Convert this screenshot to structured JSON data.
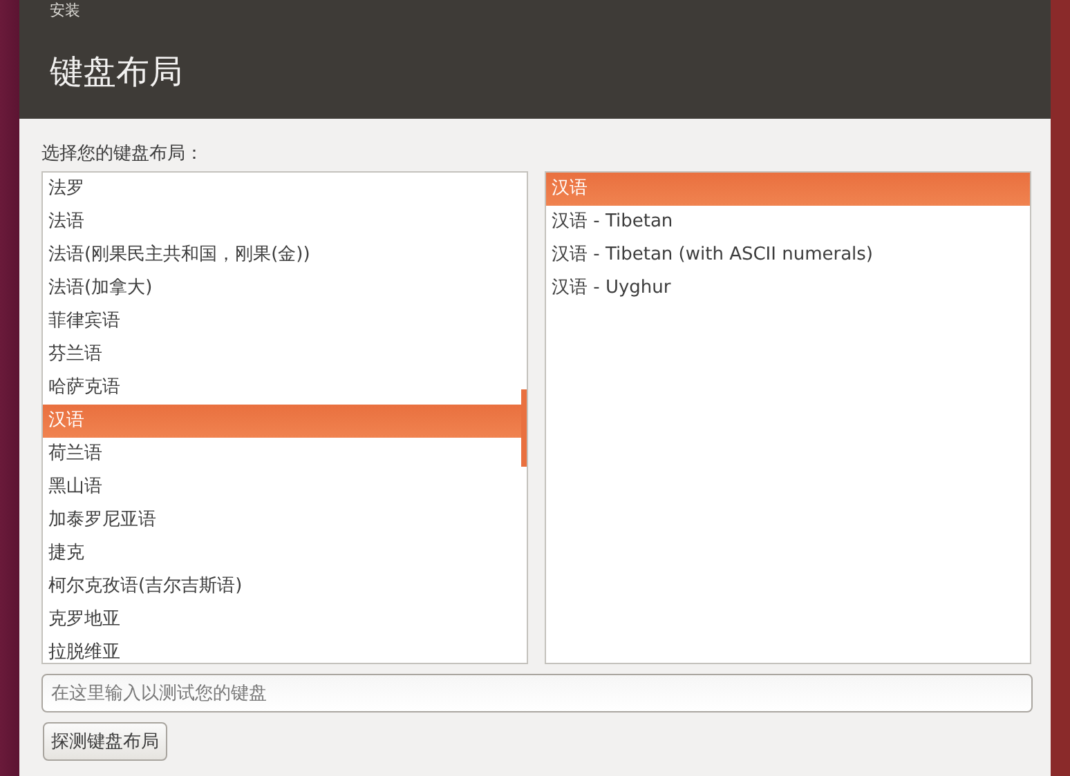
{
  "window": {
    "title": "安装"
  },
  "header": {
    "title": "键盘布局"
  },
  "prompt": "选择您的键盘布局：",
  "layouts": [
    {
      "label": "法罗",
      "selected": false
    },
    {
      "label": "法语",
      "selected": false
    },
    {
      "label": "法语(刚果民主共和国，刚果(金))",
      "selected": false
    },
    {
      "label": "法语(加拿大)",
      "selected": false
    },
    {
      "label": "菲律宾语",
      "selected": false
    },
    {
      "label": "芬兰语",
      "selected": false
    },
    {
      "label": "哈萨克语",
      "selected": false
    },
    {
      "label": "汉语",
      "selected": true
    },
    {
      "label": "荷兰语",
      "selected": false
    },
    {
      "label": "黑山语",
      "selected": false
    },
    {
      "label": "加泰罗尼亚语",
      "selected": false
    },
    {
      "label": "捷克",
      "selected": false
    },
    {
      "label": "柯尔克孜语(吉尔吉斯语)",
      "selected": false
    },
    {
      "label": "克罗地亚",
      "selected": false
    },
    {
      "label": "拉脱维亚",
      "selected": false
    }
  ],
  "variants": [
    {
      "label": "汉语",
      "selected": true
    },
    {
      "label": "汉语 - Tibetan",
      "selected": false
    },
    {
      "label": "汉语 - Tibetan (with ASCII numerals)",
      "selected": false
    },
    {
      "label": "汉语 - Uyghur",
      "selected": false
    }
  ],
  "test_field": {
    "placeholder": "在这里输入以测试您的键盘"
  },
  "detect_button": "探测键盘布局"
}
